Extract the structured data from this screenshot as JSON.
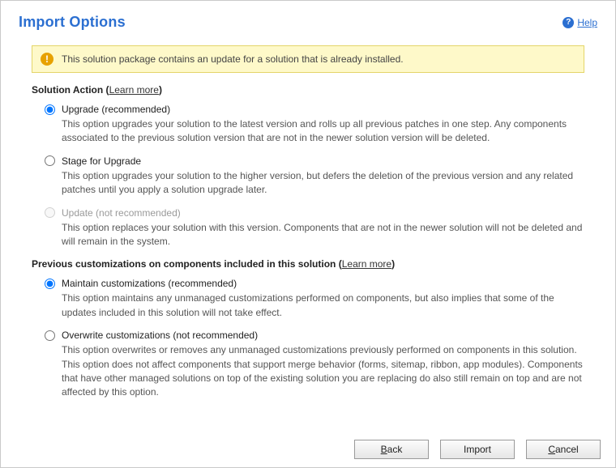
{
  "header": {
    "title": "Import Options",
    "help_label": "Help"
  },
  "banner": {
    "text": "This solution package contains an update for a solution that is already installed."
  },
  "sections": {
    "action": {
      "title": "Solution Action",
      "learn_more": "Learn more",
      "options": [
        {
          "label": "Upgrade (recommended)",
          "desc": "This option upgrades your solution to the latest version and rolls up all previous patches in one step. Any components associated to the previous solution version that are not in the newer solution version will be deleted.",
          "selected": true,
          "enabled": true
        },
        {
          "label": "Stage for Upgrade",
          "desc": "This option upgrades your solution to the higher version, but defers the deletion of the previous version and any related patches until you apply a solution upgrade later.",
          "selected": false,
          "enabled": true
        },
        {
          "label": "Update (not recommended)",
          "desc": "This option replaces your solution with this version. Components that are not in the newer solution will not be deleted and will remain in the system.",
          "selected": false,
          "enabled": false
        }
      ]
    },
    "custom": {
      "title": "Previous customizations on components included in this solution",
      "learn_more": "Learn more",
      "options": [
        {
          "label": "Maintain customizations (recommended)",
          "desc": "This option maintains any unmanaged customizations performed on components, but also implies that some of the updates included in this solution will not take effect.",
          "selected": true
        },
        {
          "label": "Overwrite customizations (not recommended)",
          "desc": "This option overwrites or removes any unmanaged customizations previously performed on components in this solution. This option does not affect components that support merge behavior (forms, sitemap, ribbon, app modules). Components that have other managed solutions on top of the existing solution you are replacing do also still remain on top and are not affected by this option.",
          "selected": false
        }
      ]
    }
  },
  "buttons": {
    "back": "Back",
    "import": "Import",
    "cancel": "Cancel"
  }
}
